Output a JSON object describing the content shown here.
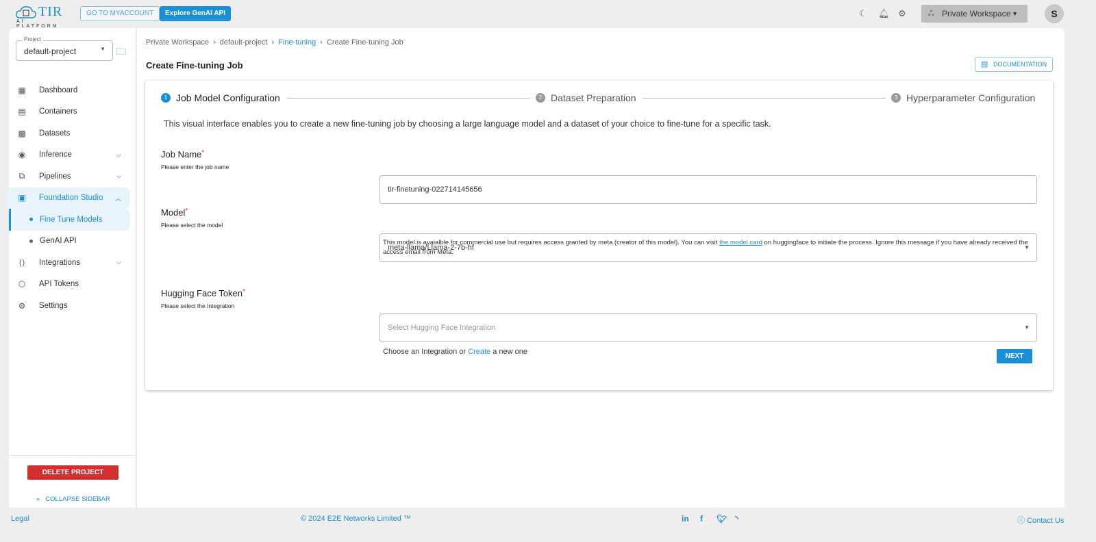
{
  "header": {
    "logo_text": "TIR",
    "logo_sub": "AI PLATFORM",
    "myaccount_label": "GO TO MYACCOUNT",
    "genai_label": "Explore GenAI API",
    "workspace_label": "Private Workspace",
    "avatar_initial": "S"
  },
  "sidebar": {
    "project_label": "Project",
    "project_value": "default-project",
    "items": [
      {
        "label": "Dashboard"
      },
      {
        "label": "Containers"
      },
      {
        "label": "Datasets"
      },
      {
        "label": "Inference"
      },
      {
        "label": "Pipelines"
      },
      {
        "label": "Foundation Studio"
      },
      {
        "label": "Fine Tune Models"
      },
      {
        "label": "GenAI API"
      },
      {
        "label": "Integrations"
      },
      {
        "label": "API Tokens"
      },
      {
        "label": "Settings"
      }
    ],
    "delete_label": "DELETE PROJECT",
    "collapse_label": "COLLAPSE SIDEBAR"
  },
  "breadcrumb": [
    "Private Workspace",
    "default-project",
    "Fine-tuning",
    "Create Fine-tuning Job"
  ],
  "page": {
    "title": "Create Fine-tuning Job",
    "doc_label": "DOCUMENTATION"
  },
  "steps": [
    {
      "num": "1",
      "label": "Job Model Configuration"
    },
    {
      "num": "2",
      "label": "Dataset Preparation"
    },
    {
      "num": "3",
      "label": "Hyperparameter Configuration"
    }
  ],
  "form": {
    "intro": "This visual interface enables you to create a new fine-tuning job by choosing a large language model and a dataset of your choice to fine-tune for a specific task.",
    "job_name": {
      "label": "Job Name",
      "hint": "Please enter the job name",
      "value": "tir-finetuning-022714145656"
    },
    "model": {
      "label": "Model",
      "hint": "Please select the model",
      "value": "meta-llama/Llama-2-7b-hf",
      "note_pre": "This model is avaialble for commercial use but requires access granted by meta (creator of this model). You can visit ",
      "note_link": "the model card",
      "note_post": " on huggingface to initiate the process. Ignore this message if you have already received the access email from Meta."
    },
    "hf_token": {
      "label": "Hugging Face Token",
      "hint": "Please select the Integration",
      "placeholder": "Select Hugging Face Integration",
      "choose_pre": "Choose an Integration or ",
      "choose_link": "Create",
      "choose_post": " a new one"
    },
    "required_mark": "*",
    "next_label": "NEXT"
  },
  "footer": {
    "legal": "Legal",
    "copyright": "© 2024 E2E Networks Limited ™",
    "contact": "Contact Us"
  }
}
